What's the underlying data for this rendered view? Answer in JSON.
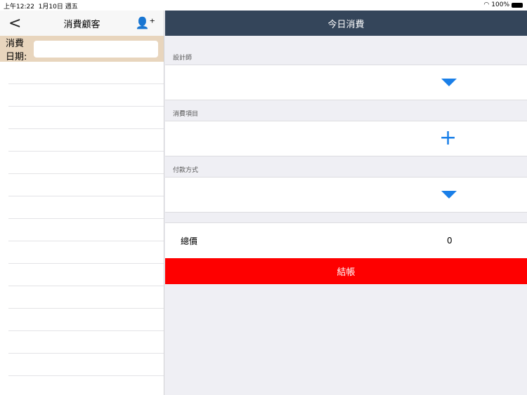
{
  "status": {
    "time": "上午12:22",
    "date": "1月10日 週五",
    "battery": "100%"
  },
  "left": {
    "title": "消費顧客",
    "date_label": "消費日期:",
    "date_value": ""
  },
  "right": {
    "title": "今日消費",
    "designer_label": "設計師",
    "items_label": "消費項目",
    "payment_label": "付款方式",
    "total_label": "總價",
    "total_value": "0",
    "checkout_label": "結帳"
  }
}
